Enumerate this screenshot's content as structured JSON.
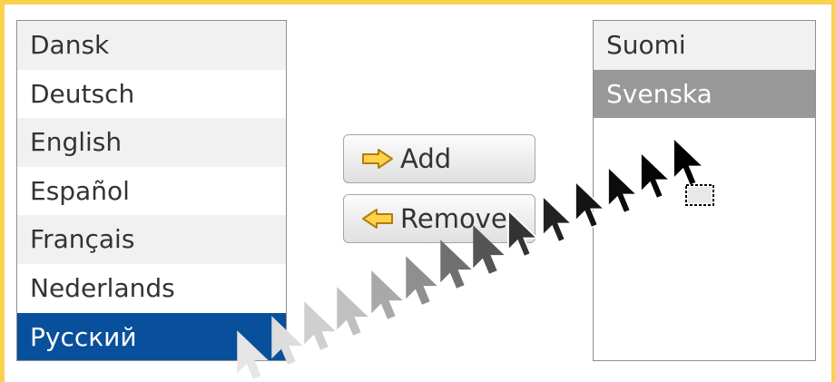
{
  "available_list": {
    "items": [
      "Dansk",
      "Deutsch",
      "English",
      "Español",
      "Français",
      "Nederlands",
      "Русский"
    ],
    "selected": "Русский"
  },
  "selected_list": {
    "items": [
      "Suomi",
      "Svenska"
    ],
    "highlighted": "Svenska"
  },
  "buttons": {
    "add_label": "Add",
    "add_icon": "arrow-right-icon",
    "remove_label": "Remove",
    "remove_icon": "arrow-left-icon"
  },
  "drag": {
    "cursor_icon": "arrow-cursor-icon",
    "drop_icon": "drag-copy-icon"
  },
  "colors": {
    "frame": "#f7d24a",
    "selection": "#08509b",
    "highlight_gray": "#989898",
    "row_stripe": "#f1f1f1",
    "arrow_icon_fill": "#ffd24a"
  }
}
